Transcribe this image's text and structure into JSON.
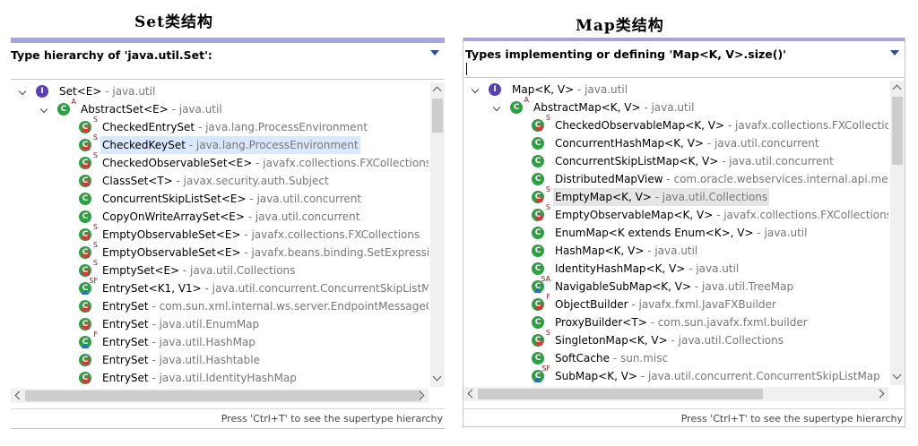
{
  "captions": {
    "left": "Set类结构",
    "right": "Map类结构"
  },
  "set_panel": {
    "title": "Type hierarchy of 'java.util.Set':",
    "status": "Press 'Ctrl+T' to see the supertype hierarchy",
    "rows": [
      {
        "name": "Set<E>",
        "pkg": " - java.util",
        "icon": "iface",
        "marks": "",
        "level": 0,
        "twisty": true
      },
      {
        "name": "AbstractSet<E>",
        "pkg": " - java.util",
        "icon": "class",
        "marks": "A",
        "level": 1,
        "twisty": true
      },
      {
        "name": "CheckedEntrySet",
        "pkg": " - java.lang.ProcessEnvironment",
        "icon": "class",
        "marks": "S",
        "lock": true,
        "level": 2
      },
      {
        "name": "CheckedKeySet",
        "pkg": " - java.lang.ProcessEnvironment",
        "icon": "class",
        "marks": "S",
        "lock": true,
        "level": 2,
        "selected": true
      },
      {
        "name": "CheckedObservableSet<E>",
        "pkg": " - javafx.collections.FXCollections",
        "icon": "class",
        "marks": "S",
        "lock": true,
        "level": 2
      },
      {
        "name": "ClassSet<T>",
        "pkg": " - javax.security.auth.Subject",
        "icon": "class",
        "marks": "",
        "lock": true,
        "level": 2
      },
      {
        "name": "ConcurrentSkipListSet<E>",
        "pkg": " - java.util.concurrent",
        "icon": "class",
        "marks": "",
        "level": 2
      },
      {
        "name": "CopyOnWriteArraySet<E>",
        "pkg": " - java.util.concurrent",
        "icon": "class",
        "marks": "",
        "level": 2
      },
      {
        "name": "EmptyObservableSet<E>",
        "pkg": " - javafx.collections.FXCollections",
        "icon": "class",
        "marks": "S",
        "lock": true,
        "level": 2
      },
      {
        "name": "EmptyObservableSet<E>",
        "pkg": " - javafx.beans.binding.SetExpression",
        "icon": "class",
        "marks": "S",
        "lock": true,
        "level": 2
      },
      {
        "name": "EmptySet<E>",
        "pkg": " - java.util.Collections",
        "icon": "class",
        "marks": "S",
        "lock": true,
        "level": 2
      },
      {
        "name": "EntrySet<K1, V1>",
        "pkg": " - java.util.concurrent.ConcurrentSkipListMap",
        "icon": "class",
        "marks": "SF",
        "tri": true,
        "level": 2
      },
      {
        "name": "EntrySet",
        "pkg": " - com.sun.xml.internal.ws.server.EndpointMessageCon",
        "icon": "class",
        "marks": "",
        "lock": true,
        "level": 2
      },
      {
        "name": "EntrySet",
        "pkg": " - java.util.EnumMap",
        "icon": "class",
        "marks": "",
        "lock": true,
        "level": 2
      },
      {
        "name": "EntrySet",
        "pkg": " - java.util.HashMap",
        "icon": "class",
        "marks": "F",
        "tri": true,
        "level": 2
      },
      {
        "name": "EntrySet",
        "pkg": " - java.util.Hashtable",
        "icon": "class",
        "marks": "",
        "lock": true,
        "level": 2
      },
      {
        "name": "EntrySet",
        "pkg": " - java.util.IdentityHashMap",
        "icon": "class",
        "marks": "",
        "lock": true,
        "level": 2
      }
    ]
  },
  "map_panel": {
    "title": "Types implementing or defining 'Map<K, V>.size()'",
    "status": "Press 'Ctrl+T' to see the supertype hierarchy",
    "rows": [
      {
        "name": "Map<K, V>",
        "pkg": " - java.util",
        "icon": "iface",
        "marks": "",
        "level": 0,
        "twisty": true
      },
      {
        "name": "AbstractMap<K, V>",
        "pkg": " - java.util",
        "icon": "class",
        "marks": "A",
        "level": 1,
        "twisty": true
      },
      {
        "name": "CheckedObservableMap<K, V>",
        "pkg": " - javafx.collections.FXCollectio",
        "icon": "class",
        "marks": "S",
        "lock": true,
        "level": 2
      },
      {
        "name": "ConcurrentHashMap<K, V>",
        "pkg": " - java.util.concurrent",
        "icon": "class",
        "marks": "",
        "level": 2
      },
      {
        "name": "ConcurrentSkipListMap<K, V>",
        "pkg": " - java.util.concurrent",
        "icon": "class",
        "marks": "",
        "level": 2
      },
      {
        "name": "DistributedMapView",
        "pkg": " - com.oracle.webservices.internal.api.mess",
        "icon": "class",
        "marks": "",
        "level": 2
      },
      {
        "name": "EmptyMap<K, V>",
        "pkg": " - java.util.Collections",
        "icon": "class",
        "marks": "S",
        "lock": true,
        "level": 2,
        "selected": true
      },
      {
        "name": "EmptyObservableMap<K, V>",
        "pkg": " - javafx.collections.FXCollections",
        "icon": "class",
        "marks": "S",
        "lock": true,
        "level": 2
      },
      {
        "name": "EnumMap<K extends Enum<K>, V>",
        "pkg": " - java.util",
        "icon": "class",
        "marks": "",
        "level": 2
      },
      {
        "name": "HashMap<K, V>",
        "pkg": " - java.util",
        "icon": "class",
        "marks": "",
        "level": 2
      },
      {
        "name": "IdentityHashMap<K, V>",
        "pkg": " - java.util",
        "icon": "class",
        "marks": "",
        "level": 2
      },
      {
        "name": "NavigableSubMap<K, V>",
        "pkg": " - java.util.TreeMap",
        "icon": "class",
        "marks": "SA",
        "tri": true,
        "level": 2
      },
      {
        "name": "ObjectBuilder",
        "pkg": " - javafx.fxml.JavaFXBuilder",
        "icon": "class",
        "marks": "F",
        "lock": true,
        "level": 2
      },
      {
        "name": "ProxyBuilder<T>",
        "pkg": " - com.sun.javafx.fxml.builder",
        "icon": "class",
        "marks": "",
        "level": 2
      },
      {
        "name": "SingletonMap<K, V>",
        "pkg": " - java.util.Collections",
        "icon": "class",
        "marks": "S",
        "lock": true,
        "level": 2
      },
      {
        "name": "SoftCache",
        "pkg": " - sun.misc",
        "icon": "class",
        "marks": "",
        "level": 2
      },
      {
        "name": "SubMap<K, V>",
        "pkg": " - java.util.concurrent.ConcurrentSkipListMap",
        "icon": "class",
        "marks": "SF",
        "tri": true,
        "level": 2
      }
    ]
  },
  "colors": {
    "accent_bar": "#a5a4dc",
    "selection": "#d9e8fb",
    "package_text": "#777777",
    "class_icon": "#2ea043",
    "interface_icon": "#5a3fb0"
  },
  "icons": {
    "class": "class-icon",
    "interface": "interface-icon",
    "expand": "chevron-down-icon",
    "menu": "view-menu-icon"
  }
}
